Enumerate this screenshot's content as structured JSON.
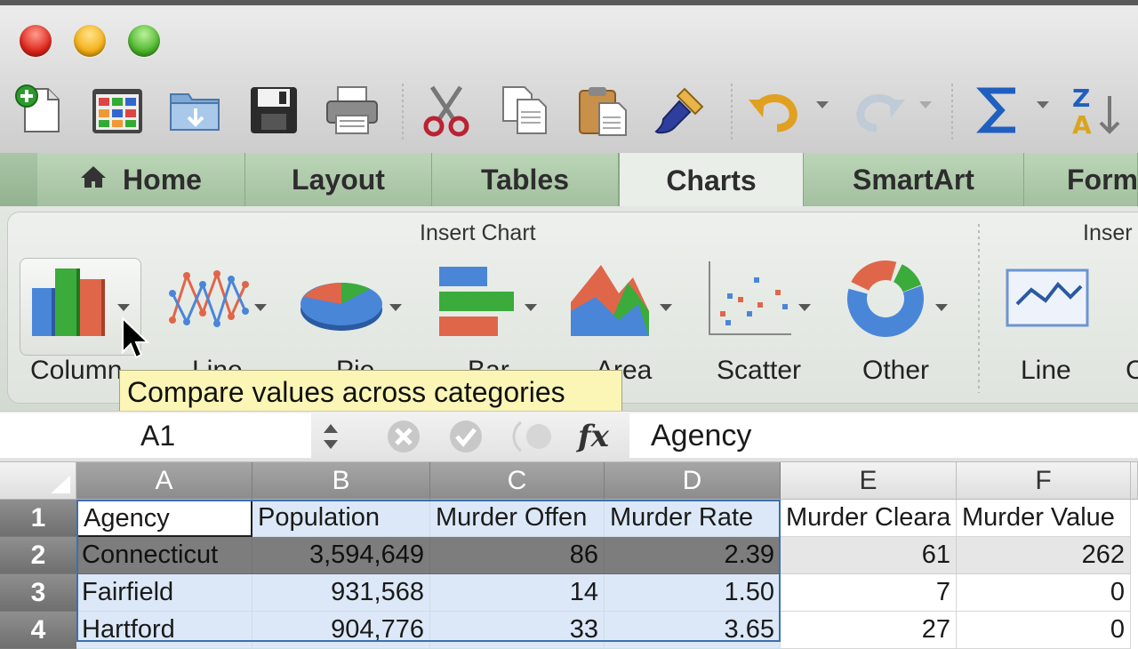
{
  "toolbar": {
    "icons": [
      "new-icon",
      "gallery-icon",
      "open-icon",
      "save-icon",
      "print-icon",
      "cut-icon",
      "copy-icon",
      "paste-icon",
      "format-painter-icon",
      "undo-icon",
      "redo-icon",
      "autosum-icon",
      "sort-icon"
    ]
  },
  "tabs": [
    {
      "label": "Home"
    },
    {
      "label": "Layout"
    },
    {
      "label": "Tables"
    },
    {
      "label": "Charts"
    },
    {
      "label": "SmartArt"
    },
    {
      "label": "Form"
    }
  ],
  "active_tab": "Charts",
  "ribbon": {
    "group_title": "Insert Chart",
    "group_title_2": "Inser",
    "buttons": [
      {
        "label": "Column"
      },
      {
        "label": "Line"
      },
      {
        "label": "Pie"
      },
      {
        "label": "Bar"
      },
      {
        "label": "Area"
      },
      {
        "label": "Scatter"
      },
      {
        "label": "Other"
      },
      {
        "label": "Line"
      },
      {
        "label": "C"
      }
    ]
  },
  "tooltip": "Compare values across categories",
  "formula_bar": {
    "name_box": "A1",
    "formula": "Agency"
  },
  "sheet": {
    "columns": [
      "A",
      "B",
      "C",
      "D",
      "E",
      "F"
    ],
    "rows": [
      "1",
      "2",
      "3",
      "4"
    ],
    "cells": [
      [
        "Agency",
        "Population",
        "Murder Offen",
        "Murder Rate",
        "Murder Cleara",
        "Murder Value"
      ],
      [
        "Connecticut",
        "3,594,649",
        "86",
        "2.39",
        "61",
        "262"
      ],
      [
        "Fairfield",
        "931,568",
        "14",
        "1.50",
        "7",
        "0"
      ],
      [
        "Hartford",
        "904,776",
        "33",
        "3.65",
        "27",
        "0"
      ]
    ]
  },
  "colors": {
    "tab_bar": "#a3c09f",
    "selection": "#dce8f7",
    "tooltip": "#fbf6b5"
  }
}
